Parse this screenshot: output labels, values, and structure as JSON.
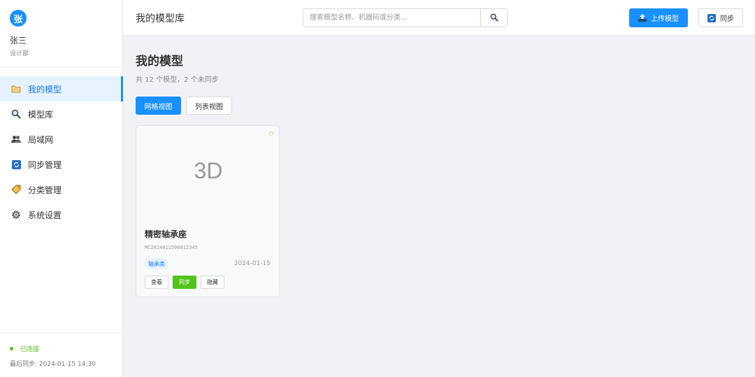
{
  "user": {
    "avatar_text": "张",
    "name": "张三",
    "dept": "设计部"
  },
  "sidebar": {
    "items": [
      {
        "label": "我的模型",
        "icon": "folder-icon"
      },
      {
        "label": "模型库",
        "icon": "search-icon"
      },
      {
        "label": "局域网",
        "icon": "users-icon"
      },
      {
        "label": "同步管理",
        "icon": "sync-icon"
      },
      {
        "label": "分类管理",
        "icon": "tag-icon"
      },
      {
        "label": "系统设置",
        "icon": "gear-icon"
      }
    ],
    "active": 0
  },
  "status": {
    "connection": "已连接",
    "last_sync": "最后同步: 2024-01-15 14:30"
  },
  "header": {
    "title": "我的模型库",
    "search_placeholder": "搜索模型名称、机器码或分类...",
    "upload_label": "上传模型",
    "sync_label": "同步"
  },
  "main": {
    "title": "我的模型",
    "subtitle": "共 12 个模型，2 个未同步",
    "view_grid_label": "网格视图",
    "view_list_label": "列表视图",
    "cards": [
      {
        "preview": "3D",
        "name": "精密轴承座",
        "code": "MC2024011500012345",
        "tag": "轴承类",
        "date": "2024-01-15",
        "actions": {
          "view": "查看",
          "sync": "同步",
          "hide": "隐藏"
        }
      }
    ]
  },
  "colors": {
    "primary": "#1890ff",
    "success": "#52c41a",
    "background": "#f0f2f5"
  }
}
